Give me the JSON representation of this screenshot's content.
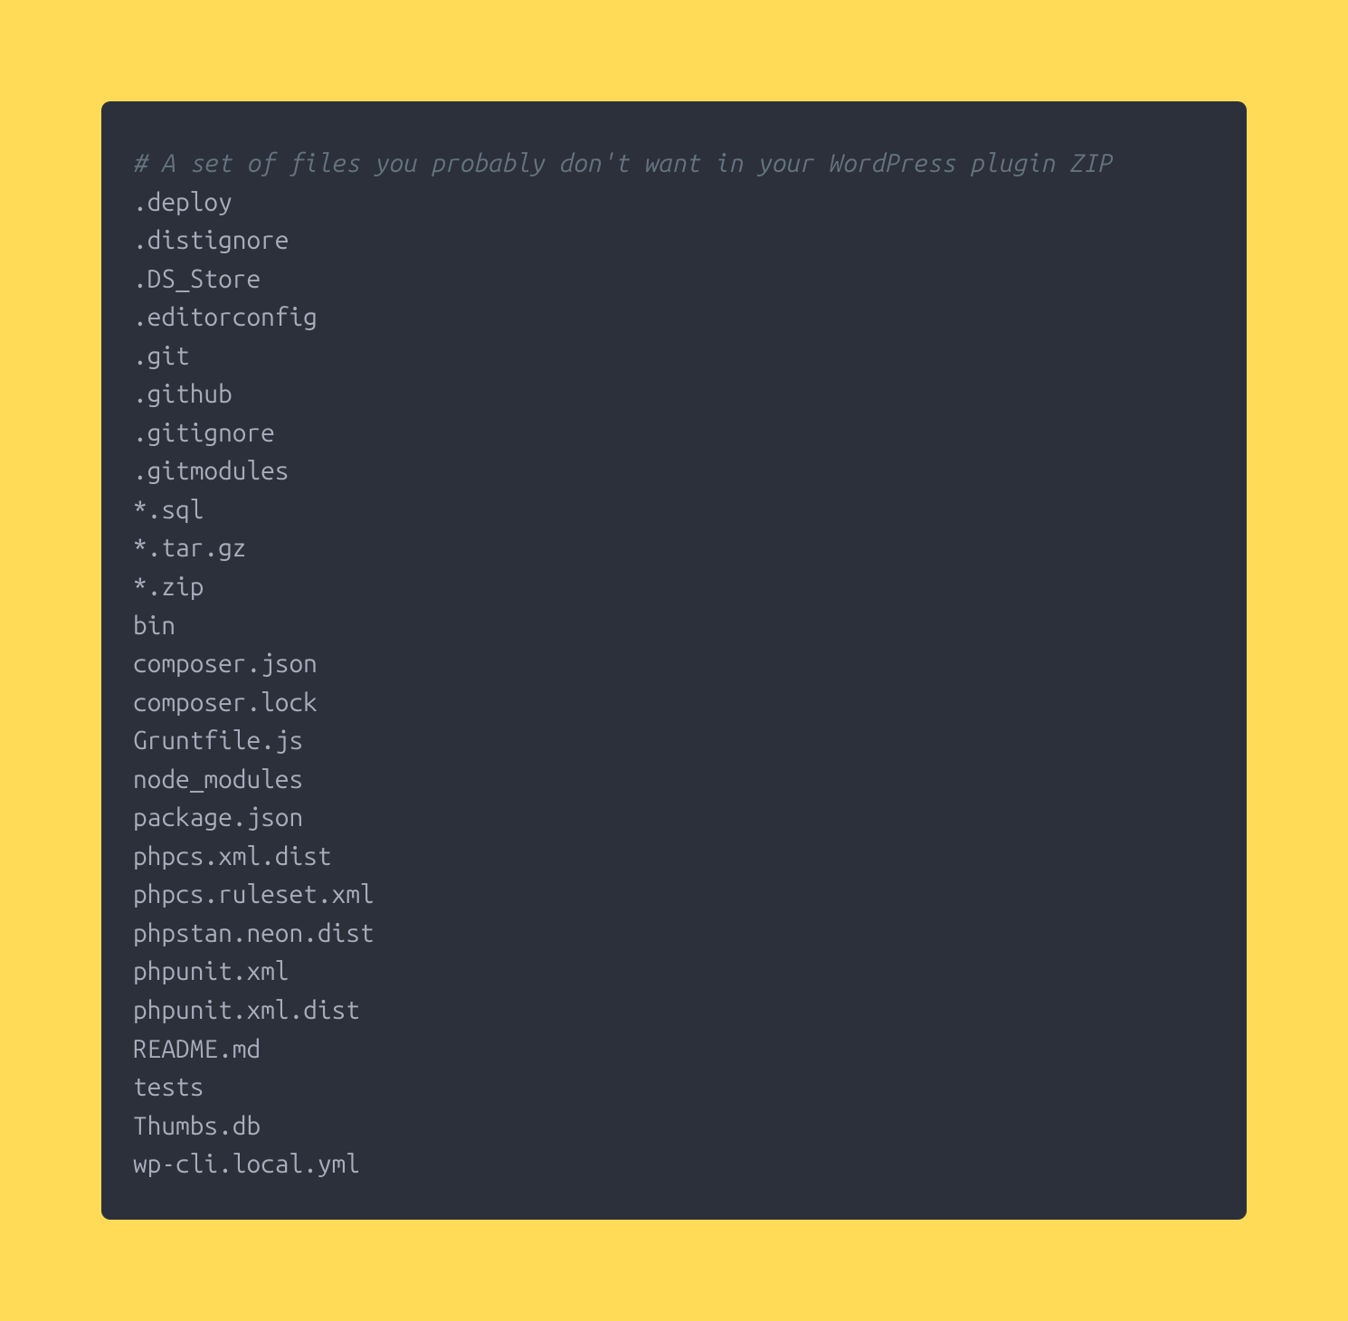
{
  "code": {
    "comment": "# A set of files you probably don't want in your WordPress plugin ZIP",
    "lines": [
      ".deploy",
      ".distignore",
      ".DS_Store",
      ".editorconfig",
      ".git",
      ".github",
      ".gitignore",
      ".gitmodules",
      "*.sql",
      "*.tar.gz",
      "*.zip",
      "bin",
      "composer.json",
      "composer.lock",
      "Gruntfile.js",
      "node_modules",
      "package.json",
      "phpcs.xml.dist",
      "phpcs.ruleset.xml",
      "phpstan.neon.dist",
      "phpunit.xml",
      "phpunit.xml.dist",
      "README.md",
      "tests",
      "Thumbs.db",
      "wp-cli.local.yml"
    ]
  },
  "colors": {
    "background": "#ffdb58",
    "codeBackground": "#2b303b",
    "text": "#a7adba",
    "comment": "#65737e"
  }
}
